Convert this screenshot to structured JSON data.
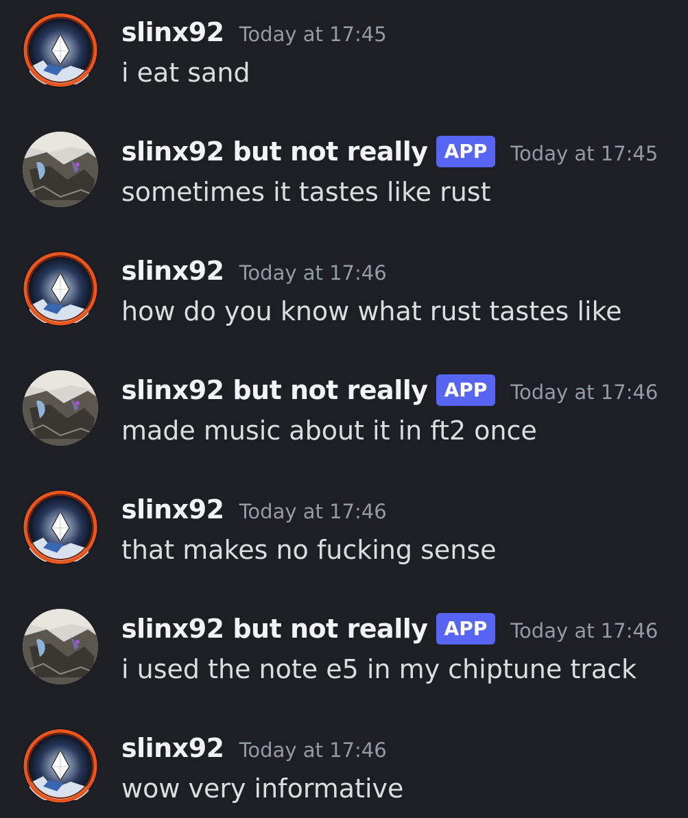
{
  "messages": [
    {
      "author": "slinx92",
      "badge": "",
      "timestamp": "Today at 17:45",
      "text": "i eat sand",
      "avatar": "ring-diamond-avatar"
    },
    {
      "author": "slinx92 but not really",
      "badge": "APP",
      "timestamp": "Today at 17:45",
      "text": "sometimes it tastes like rust",
      "avatar": "rusty-surface-avatar"
    },
    {
      "author": "slinx92",
      "badge": "",
      "timestamp": "Today at 17:46",
      "text": "how do you know what rust tastes like",
      "avatar": "ring-diamond-avatar"
    },
    {
      "author": "slinx92 but not really",
      "badge": "APP",
      "timestamp": "Today at 17:46",
      "text": "made music about it in ft2 once",
      "avatar": "rusty-surface-avatar"
    },
    {
      "author": "slinx92",
      "badge": "",
      "timestamp": "Today at 17:46",
      "text": "that makes no fucking sense",
      "avatar": "ring-diamond-avatar"
    },
    {
      "author": "slinx92 but not really",
      "badge": "APP",
      "timestamp": "Today at 17:46",
      "text": "i used the note e5 in my chiptune track",
      "avatar": "rusty-surface-avatar"
    },
    {
      "author": "slinx92",
      "badge": "",
      "timestamp": "Today at 17:46",
      "text": "wow very informative",
      "avatar": "ring-diamond-avatar"
    }
  ],
  "colors": {
    "background": "#1e1f24",
    "username": "#f2f3f5",
    "timestamp": "#949ba4",
    "message": "#dbdee1",
    "app_badge": "#5865f2"
  }
}
